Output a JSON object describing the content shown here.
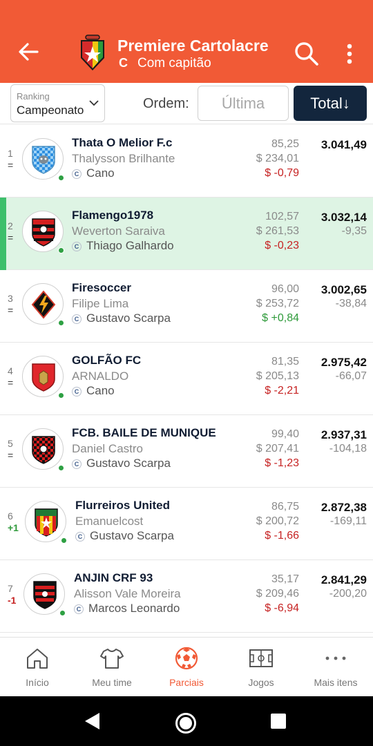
{
  "header": {
    "title": "Premiere Cartolacre",
    "captain_badge": "C",
    "subtitle": "Com capitão",
    "color": "#f15a36"
  },
  "filters": {
    "ranking_label": "Ranking",
    "ranking_value": "Campeonato",
    "order_label": "Ordem:",
    "btn_last": "Última",
    "btn_total": "Total↓"
  },
  "teams": [
    {
      "position": "1",
      "variation": "=",
      "name": "Thata O Melior F.c",
      "owner": "Thalysson Brilhante",
      "captain": "Cano",
      "round_points": "85,25",
      "cash": "$ 234,01",
      "cash_change": "$ -0,79",
      "total": "3.041,49",
      "diff": "",
      "highlight": false
    },
    {
      "position": "2",
      "variation": "=",
      "name": "Flamengo1978",
      "owner": "Weverton Saraiva",
      "captain": "Thiago Galhardo",
      "round_points": "102,57",
      "cash": "$ 261,53",
      "cash_change": "$ -0,23",
      "total": "3.032,14",
      "diff": "-9,35",
      "highlight": true
    },
    {
      "position": "3",
      "variation": "=",
      "name": "Firesoccer",
      "owner": "Filipe Lima",
      "captain": "Gustavo Scarpa",
      "round_points": "96,00",
      "cash": "$ 253,72",
      "cash_change": "$ +0,84",
      "total": "3.002,65",
      "diff": "-38,84",
      "highlight": false
    },
    {
      "position": "4",
      "variation": "=",
      "name": "GOLFÃO FC",
      "owner": "ARNALDO",
      "captain": "Cano",
      "round_points": "81,35",
      "cash": "$ 205,13",
      "cash_change": "$ -2,21",
      "total": "2.975,42",
      "diff": "-66,07",
      "highlight": false
    },
    {
      "position": "5",
      "variation": "=",
      "name": "FCB. BAILE DE MUNIQUE",
      "owner": "Daniel Castro",
      "captain": "Gustavo Scarpa",
      "round_points": "99,40",
      "cash": "$ 207,41",
      "cash_change": "$ -1,23",
      "total": "2.937,31",
      "diff": "-104,18",
      "highlight": false
    },
    {
      "position": "6",
      "variation": "+1",
      "name": "Flurreiros United",
      "owner": "Emanuelcost",
      "captain": "Gustavo Scarpa",
      "round_points": "86,75",
      "cash": "$ 200,72",
      "cash_change": "$ -1,66",
      "total": "2.872,38",
      "diff": "-169,11",
      "highlight": false
    },
    {
      "position": "7",
      "variation": "-1",
      "name": "ANJIN CRF 93",
      "owner": "Alisson Vale Moreira",
      "captain": "Marcos Leonardo",
      "round_points": "35,17",
      "cash": "$ 209,46",
      "cash_change": "$ -6,94",
      "total": "2.841,29",
      "diff": "-200,20",
      "highlight": false
    }
  ],
  "bottom_nav": [
    {
      "label": "Início",
      "icon": "home-icon"
    },
    {
      "label": "Meu time",
      "icon": "shirt-icon"
    },
    {
      "label": "Parciais",
      "icon": "soccer-ball-icon",
      "active": true
    },
    {
      "label": "Jogos",
      "icon": "field-icon"
    },
    {
      "label": "Mais itens",
      "icon": "more-dots-icon"
    }
  ],
  "colors": {
    "accent": "#f15a36",
    "dark": "#13263d",
    "highlight_bg": "#def4e4",
    "negative": "#c62222",
    "positive": "#2e9a3a"
  }
}
